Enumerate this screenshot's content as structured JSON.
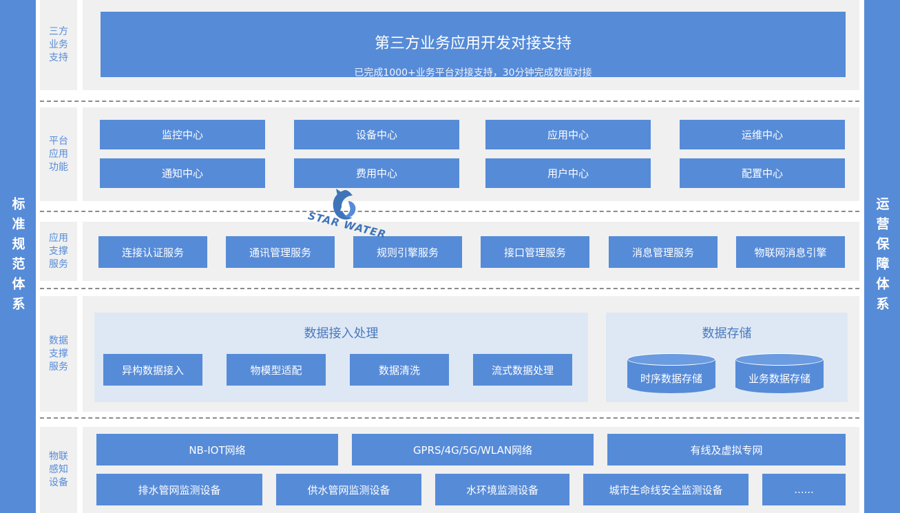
{
  "sides": {
    "left": "标准规范体系",
    "right": "运营保障体系"
  },
  "layers": {
    "third_party": {
      "label": "三方业务支持",
      "title": "第三方业务应用开发对接支持",
      "subtitle": "已完成1000+业务平台对接支持，30分钟完成数据对接"
    },
    "platform": {
      "label": "平台应用功能",
      "items": [
        "监控中心",
        "设备中心",
        "应用中心",
        "运维中心",
        "通知中心",
        "费用中心",
        "用户中心",
        "配置中心"
      ]
    },
    "app_support": {
      "label": "应用支撑服务",
      "items": [
        "连接认证服务",
        "通讯管理服务",
        "规则引擎服务",
        "接口管理服务",
        "消息管理服务",
        "物联网消息引擎"
      ]
    },
    "data_support": {
      "label": "数据支撑服务",
      "ingest_title": "数据接入处理",
      "ingest_items": [
        "异构数据接入",
        "物模型适配",
        "数据清洗",
        "流式数据处理"
      ],
      "storage_title": "数据存储",
      "storage_items": [
        "时序数据存储",
        "业务数据存储"
      ]
    },
    "iot": {
      "label": "物联感知设备",
      "networks": [
        "NB-IOT网络",
        "GPRS/4G/5G/WLAN网络",
        "有线及虚拟专网"
      ],
      "devices": [
        "排水管网监测设备",
        "供水管网监测设备",
        "水环境监测设备",
        "城市生命线安全监测设备",
        "......"
      ]
    }
  },
  "watermark": {
    "text": "STAR WATER",
    "icon": "star-water-logo-icon"
  }
}
